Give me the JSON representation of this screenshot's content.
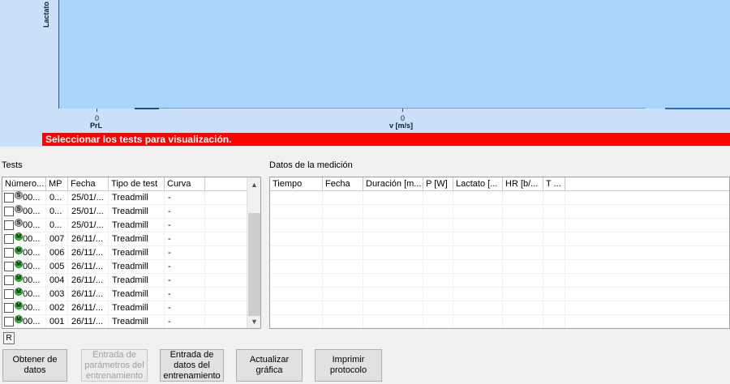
{
  "chart": {
    "y_label": "Lactato",
    "x_ticks": [
      {
        "label": "0",
        "sub": "PrL"
      },
      {
        "label": "0",
        "sub": "v [m/s]"
      }
    ],
    "alert": "Seleccionar los tests para visualización."
  },
  "tests": {
    "title": "Tests",
    "columns": [
      "Número...",
      "MP",
      "Fecha",
      "Tipo de test",
      "Curva"
    ],
    "rows": [
      {
        "num": "00...",
        "badge": "S",
        "mp": "0...",
        "fecha": "25/01/...",
        "tipo": "Treadmill",
        "curva": "-"
      },
      {
        "num": "00...",
        "badge": "S",
        "mp": "0...",
        "fecha": "25/01/...",
        "tipo": "Treadmill",
        "curva": "-"
      },
      {
        "num": "00...",
        "badge": "S",
        "mp": "0...",
        "fecha": "25/01/...",
        "tipo": "Treadmill",
        "curva": "-"
      },
      {
        "num": "00...",
        "badge": "M",
        "mp": "007",
        "fecha": "26/11/...",
        "tipo": "Treadmill",
        "curva": "-"
      },
      {
        "num": "00...",
        "badge": "M",
        "mp": "006",
        "fecha": "26/11/...",
        "tipo": "Treadmill",
        "curva": "-"
      },
      {
        "num": "00...",
        "badge": "M",
        "mp": "005",
        "fecha": "26/11/...",
        "tipo": "Treadmill",
        "curva": "-"
      },
      {
        "num": "00...",
        "badge": "M",
        "mp": "004",
        "fecha": "26/11/...",
        "tipo": "Treadmill",
        "curva": "-"
      },
      {
        "num": "00...",
        "badge": "M",
        "mp": "003",
        "fecha": "26/11/...",
        "tipo": "Treadmill",
        "curva": "-"
      },
      {
        "num": "00...",
        "badge": "M",
        "mp": "002",
        "fecha": "26/11/...",
        "tipo": "Treadmill",
        "curva": "-"
      },
      {
        "num": "00...",
        "badge": "M",
        "mp": "001",
        "fecha": "26/11/...",
        "tipo": "Treadmill",
        "curva": "-"
      }
    ]
  },
  "measurement": {
    "title": "Datos de la medición",
    "columns": [
      "Tiempo",
      "Fecha",
      "Duración [m...",
      "P [W]",
      "Lactato [...",
      "HR [b/...",
      "T ..."
    ]
  },
  "small_button": "R",
  "buttons": [
    {
      "label": "Obtener de\ndatos",
      "enabled": true
    },
    {
      "label": "Entrada de\nparámetros del\nentrenamiento",
      "enabled": false
    },
    {
      "label": "Entrada de\ndatos del\nentrenamiento",
      "enabled": true
    },
    {
      "label": "Actualizar\ngráfica",
      "enabled": true
    },
    {
      "label": "Imprimir\nprotocolo",
      "enabled": true
    }
  ]
}
